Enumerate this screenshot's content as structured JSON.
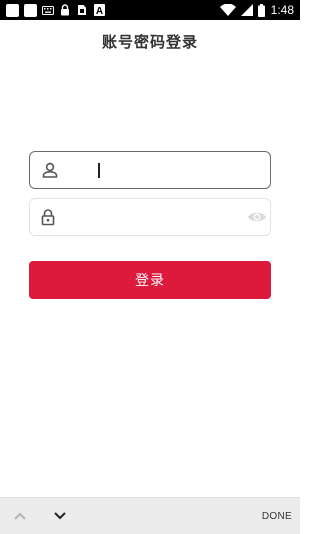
{
  "status_bar": {
    "time": "1:48",
    "icons": [
      "notification-square-icon",
      "notification-square-icon",
      "keyboard-icon",
      "lock-icon",
      "sim-card-icon",
      "a-letter-icon",
      "wifi-icon",
      "signal-icon",
      "battery-icon"
    ],
    "a_letter": "A"
  },
  "header": {
    "title": "账号密码登录"
  },
  "form": {
    "username": {
      "value": "",
      "placeholder": "",
      "icon": "user-icon"
    },
    "password": {
      "value": "",
      "placeholder": "",
      "icon": "lock-icon",
      "toggle_icon": "eye-icon"
    },
    "login_label": "登录"
  },
  "keyboard_bar": {
    "prev_icon": "chevron-up-icon",
    "next_icon": "chevron-down-icon",
    "done_label": "DONE"
  },
  "colors": {
    "primary": "#de1a3c",
    "status_bar": "#000000",
    "keyboard_bar": "#ececec"
  }
}
